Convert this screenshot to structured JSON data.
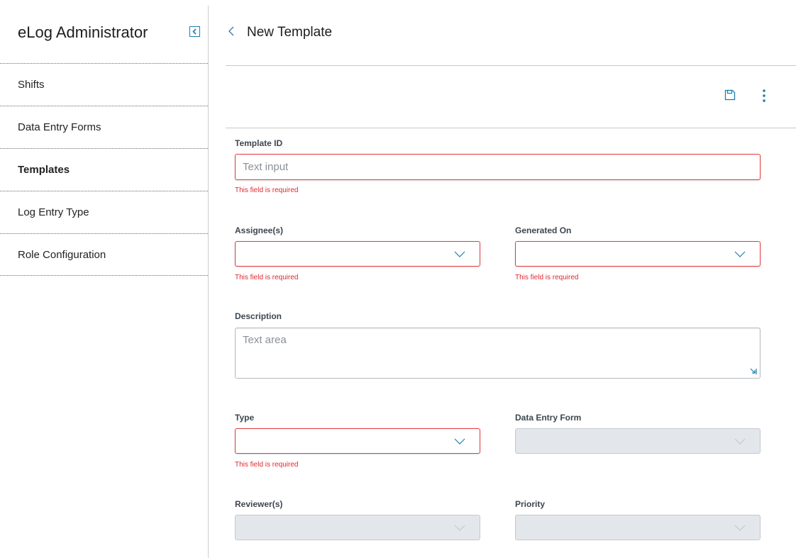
{
  "sidebar": {
    "title": "eLog Administrator",
    "items": [
      {
        "label": "Shifts"
      },
      {
        "label": "Data Entry Forms"
      },
      {
        "label": "Templates"
      },
      {
        "label": "Log Entry Type"
      },
      {
        "label": "Role Configuration"
      }
    ],
    "active_item": "Templates"
  },
  "header": {
    "title": "New Template"
  },
  "form": {
    "template_id": {
      "label": "Template ID",
      "placeholder": "Text input",
      "error": "This field is required"
    },
    "assignees": {
      "label": "Assignee(s)",
      "value": "",
      "error": "This field is required"
    },
    "generated_on": {
      "label": "Generated On",
      "value": "",
      "error": "This field is required"
    },
    "description": {
      "label": "Description",
      "placeholder": "Text area"
    },
    "type": {
      "label": "Type",
      "value": "",
      "error": "This field is required"
    },
    "data_entry_form": {
      "label": "Data Entry Form",
      "value": ""
    },
    "reviewers": {
      "label": "Reviewer(s)",
      "value": ""
    },
    "priority": {
      "label": "Priority",
      "value": ""
    }
  },
  "colors": {
    "accent": "#1a7fa8",
    "error": "#e0282e",
    "disabled_bg": "#e3e7eb"
  },
  "icons": [
    "collapse-sidebar-icon",
    "back-chevron-icon",
    "save-icon",
    "more-vertical-icon",
    "chevron-down-icon",
    "resize-handle-icon"
  ]
}
